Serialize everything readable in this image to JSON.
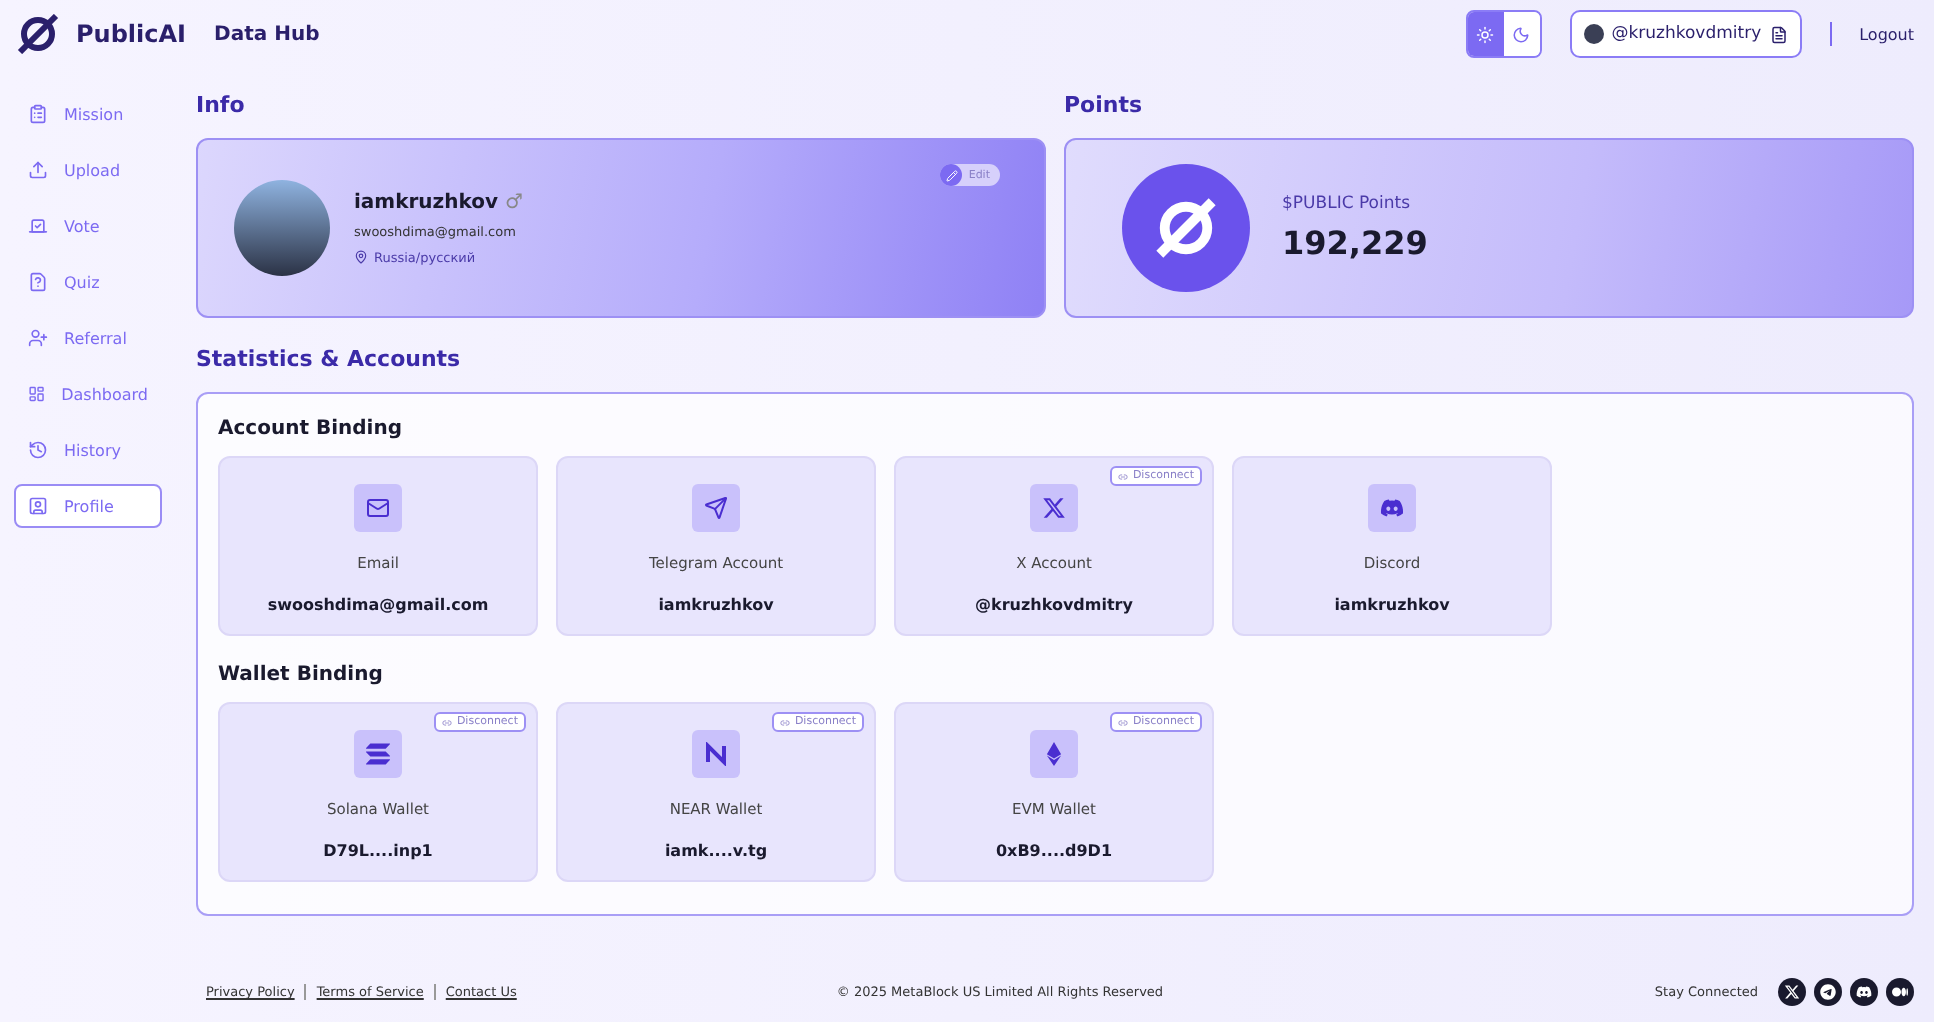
{
  "header": {
    "brand": "PublicAI",
    "product": "Data Hub",
    "theme_options": [
      {
        "kind": "light",
        "selected": true
      },
      {
        "kind": "dark",
        "selected": false
      }
    ],
    "account": "@kruzhkovdmitry",
    "logout": "Logout"
  },
  "sidebar": {
    "items": [
      {
        "label": "Mission",
        "selected": false
      },
      {
        "label": "Upload",
        "selected": false
      },
      {
        "label": "Vote",
        "selected": false
      },
      {
        "label": "Quiz",
        "selected": false
      },
      {
        "label": "Referral",
        "selected": false
      },
      {
        "label": "Dashboard",
        "selected": false
      },
      {
        "label": "History",
        "selected": false
      },
      {
        "label": "Profile",
        "selected": true
      }
    ]
  },
  "info": {
    "title": "Info",
    "username": "iamkruzhkov",
    "gender_symbol": "♂",
    "email": "swooshdima@gmail.com",
    "locale": "Russia/русский",
    "edit": "Edit"
  },
  "points": {
    "title": "Points",
    "label": "$PUBLIC Points",
    "value": "192,229"
  },
  "statistics": {
    "title": "Statistics & Accounts",
    "account_binding": {
      "title": "Account Binding",
      "items": [
        {
          "kind": "email",
          "label": "Email",
          "value": "swooshdima@gmail.com"
        },
        {
          "kind": "telegram",
          "label": "Telegram Account",
          "value": "iamkruzhkov"
        },
        {
          "kind": "x",
          "label": "X Account",
          "value": "@kruzhkovdmitry",
          "disconnect": "Disconnect"
        },
        {
          "kind": "discord",
          "label": "Discord",
          "value": "iamkruzhkov"
        }
      ]
    },
    "wallet_binding": {
      "title": "Wallet Binding",
      "items": [
        {
          "kind": "solana",
          "label": "Solana Wallet",
          "value": "D79L....inp1",
          "disconnect": "Disconnect"
        },
        {
          "kind": "near",
          "label": "NEAR Wallet",
          "value": "iamk....v.tg",
          "disconnect": "Disconnect"
        },
        {
          "kind": "evm",
          "label": "EVM Wallet",
          "value": "0xB9....d9D1",
          "disconnect": "Disconnect"
        }
      ]
    }
  },
  "footer": {
    "links": [
      "Privacy Policy",
      "Terms of Service",
      "Contact Us"
    ],
    "copyright": "© 2025 MetaBlock US Limited All Rights Reserved",
    "social_label": "Stay Connected"
  }
}
